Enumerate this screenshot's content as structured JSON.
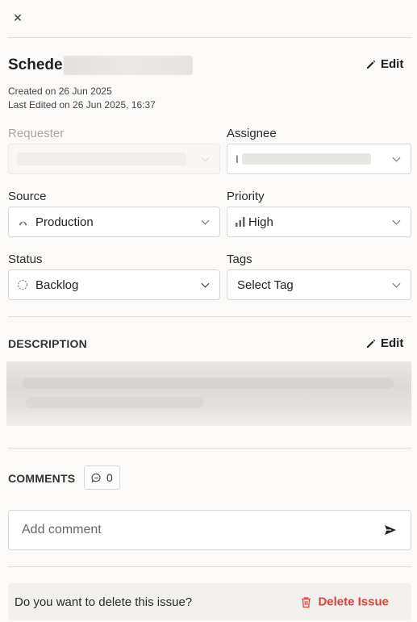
{
  "header": {
    "close_icon": "close-icon"
  },
  "issue": {
    "title_prefix": "Schede",
    "edit_label": "Edit",
    "created": "Created on 26 Jun 2025",
    "last_edited": "Last Edited on 26 Jun 2025, 16:37"
  },
  "fields": {
    "requester": {
      "label": "Requester",
      "value": ""
    },
    "assignee": {
      "label": "Assignee",
      "value": "I"
    },
    "source": {
      "label": "Source",
      "value": "Production",
      "icon": "production-icon"
    },
    "priority": {
      "label": "Priority",
      "value": "High",
      "icon": "signal-bars-icon"
    },
    "status": {
      "label": "Status",
      "value": "Backlog",
      "icon": "dashed-circle-icon"
    },
    "tags": {
      "label": "Tags",
      "value": "Select Tag"
    }
  },
  "description": {
    "title": "DESCRIPTION",
    "edit_label": "Edit"
  },
  "comments": {
    "title": "COMMENTS",
    "count": "0",
    "placeholder": "Add comment"
  },
  "delete": {
    "question": "Do you want to delete this issue?",
    "button_label": "Delete Issue",
    "accent": "#e0403a"
  }
}
